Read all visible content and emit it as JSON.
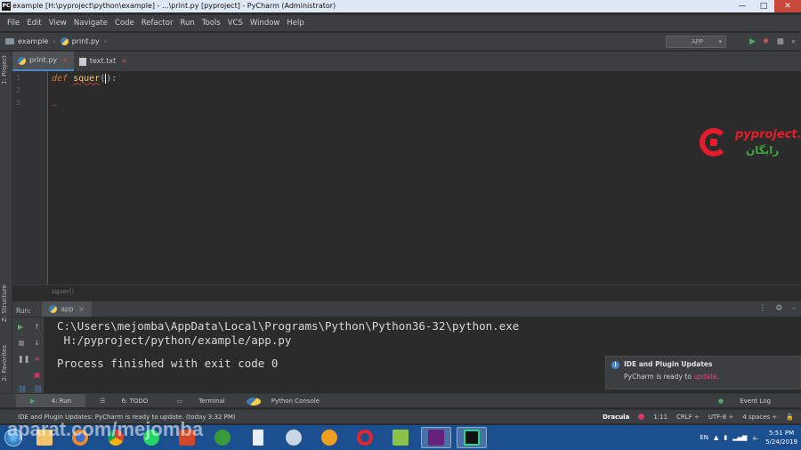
{
  "window": {
    "title": "example [H:\\pyproject\\python\\example] - ...\\print.py [pyproject] - PyCharm (Administrator)",
    "app_icon": "PC",
    "minimize": "—",
    "maximize": "□",
    "close": "✕"
  },
  "menu": [
    "File",
    "Edit",
    "View",
    "Navigate",
    "Code",
    "Refactor",
    "Run",
    "Tools",
    "VCS",
    "Window",
    "Help"
  ],
  "nav": {
    "project": "example",
    "file": "print.py",
    "run_config": "APP"
  },
  "sidebar": {
    "project_label": "1: Project",
    "structure_label": "Z: Structure",
    "favorites_label": "2: Favorites"
  },
  "tabs": [
    {
      "label": "print.py"
    },
    {
      "label": "text.txt"
    }
  ],
  "editor": {
    "lines": [
      "1",
      "2",
      "3"
    ],
    "keyword": "def",
    "function": "squer",
    "open_paren": "(",
    "close_suffix": "):",
    "breadcrumb": "squer()"
  },
  "logo": {
    "brand": "pyproject.ir",
    "tag": "رایگان"
  },
  "run": {
    "label": "Run:",
    "tab": "app",
    "output_line1": "C:\\Users\\mejomba\\AppData\\Local\\Programs\\Python\\Python36-32\\python.exe",
    "output_line2": " H:/pyproject/python/example/app.py",
    "output_line3": "Process finished with exit code 0"
  },
  "notification": {
    "title": "IDE and Plugin Updates",
    "message": "PyCharm is ready to",
    "link": "update",
    "end": "."
  },
  "tool_tabs": [
    "4: Run",
    "6: TODO",
    "Terminal",
    "Python Console"
  ],
  "event_log": "Event Log",
  "status": {
    "message": "IDE and Plugin Updates: PyCharm is ready to update. (today 3:32 PM)",
    "theme": "Dracula",
    "position": "1:11",
    "line_sep": "CRLF ÷",
    "encoding": "UTF-8 ÷",
    "indent": "4 spaces ÷"
  },
  "taskbar": {
    "watermark": "aparat.com/mejomba",
    "lang": "EN",
    "time": "5:51 PM",
    "date": "5/24/2019"
  }
}
